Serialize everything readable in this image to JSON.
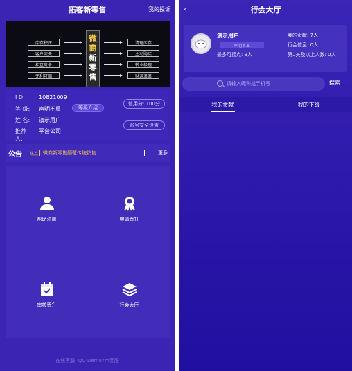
{
  "left": {
    "title": "拓客新零售",
    "header_right": "我的投诉",
    "banner": {
      "left_items": [
        "库存积压",
        "客户流失",
        "相互竞争",
        "无利可图"
      ],
      "center_chars": [
        "微",
        "商",
        "新",
        "零",
        "售"
      ],
      "right_items": [
        "清理库存",
        "主动购买",
        "转业极理",
        "财源滚滚"
      ]
    },
    "info": {
      "id_label": "I D:",
      "id_value": "10821009",
      "level_label": "等 级:",
      "level_value": "声明不显",
      "level_button": "等级介绍",
      "credit_button": "信用分: 100分",
      "name_label": "姓 名:",
      "name_value": "演示用户",
      "referrer_label": "推荐人:",
      "referrer_value": "平台公司",
      "security_button": "账号安全设置"
    },
    "notice": {
      "title": "公告",
      "tag": "热点",
      "text": "微商新零售颠覆传统销售",
      "more": "更多"
    },
    "grid": [
      {
        "label": "帮助注册",
        "icon": "user-icon"
      },
      {
        "label": "申请晋升",
        "icon": "award-icon"
      },
      {
        "label": "审核晋升",
        "icon": "calendar-check-icon"
      },
      {
        "label": "行会大厅",
        "icon": "layers-icon"
      }
    ],
    "footer": "在线客服: QQ DemoYm客服"
  },
  "right": {
    "title": "行会大厅",
    "user": {
      "name": "演示用户",
      "level": "声明不显",
      "sub": "最多可接点: 3人",
      "contribution": "我的贡献: 7人",
      "guild_info": "行会信息: 0人",
      "tier_count": "第1关及以上人数: 0人"
    },
    "search": {
      "placeholder": "请输入昵称或手机号",
      "button": "搜索"
    },
    "tabs": [
      "我的贡献",
      "我的下级"
    ]
  }
}
